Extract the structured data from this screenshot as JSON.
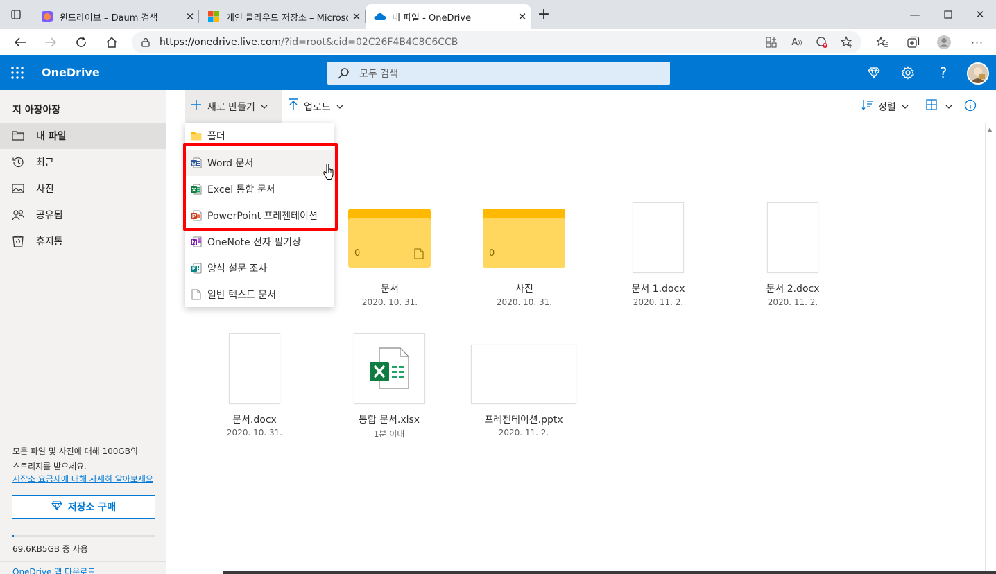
{
  "browser": {
    "tabs": [
      {
        "title": "윈드라이브 – Daum 검색",
        "active": false
      },
      {
        "title": "개인 클라우드 저장소 – Microsoft",
        "active": false
      },
      {
        "title": "내 파일 - OneDrive",
        "active": true
      }
    ],
    "url_host": "https://onedrive.live.com",
    "url_path": "/?id=root&cid=02C26F4B4C8C6CCB"
  },
  "header": {
    "brand": "OneDrive",
    "search_placeholder": "모두 검색"
  },
  "sidebar": {
    "user_name": "지 아장아장",
    "items": [
      {
        "label": "내 파일",
        "icon": "folder-icon",
        "selected": true
      },
      {
        "label": "최근",
        "icon": "history-icon",
        "selected": false
      },
      {
        "label": "사진",
        "icon": "photo-icon",
        "selected": false
      },
      {
        "label": "공유됨",
        "icon": "people-icon",
        "selected": false
      },
      {
        "label": "휴지통",
        "icon": "recycle-bin-icon",
        "selected": false
      }
    ],
    "promo_line1": "모든 파일 및 사진에 대해 100GB의",
    "promo_line2": "스토리지를 받으세요.",
    "promo_link": "저장소 요금제에 대해 자세히 알아보세요",
    "buy_label": "저장소 구매",
    "usage_text": "69.6KB5GB 중 사용",
    "download_link": "OneDrive 앱 다운로드"
  },
  "commands": {
    "new_label": "새로 만들기",
    "upload_label": "업로드",
    "sort_label": "정렬"
  },
  "new_menu": [
    {
      "label": "폴더",
      "icon": "folder-icon"
    },
    {
      "label": "Word 문서",
      "icon": "word-icon"
    },
    {
      "label": "Excel 통합 문서",
      "icon": "excel-icon"
    },
    {
      "label": "PowerPoint 프레젠테이션",
      "icon": "powerpoint-icon"
    },
    {
      "label": "OneNote 전자 필기장",
      "icon": "onenote-icon"
    },
    {
      "label": "양식 설문 조사",
      "icon": "forms-icon"
    },
    {
      "label": "일반 텍스트 문서",
      "icon": "text-file-icon"
    }
  ],
  "files": {
    "row1": [
      {
        "name": "문서",
        "date": "2020. 10. 31.",
        "type": "folder",
        "count": "0"
      },
      {
        "name": "사진",
        "date": "2020. 10. 31.",
        "type": "folder",
        "count": "0"
      },
      {
        "name": "문서 1.docx",
        "date": "2020. 11. 2.",
        "type": "docx"
      },
      {
        "name": "문서 2.docx",
        "date": "2020. 11. 2.",
        "type": "docx"
      }
    ],
    "row2": [
      {
        "name": "문서.docx",
        "date": "2020. 10. 31.",
        "type": "docx"
      },
      {
        "name": "통합 문서.xlsx",
        "date": "1분 이내",
        "type": "xlsx"
      },
      {
        "name": "프레젠테이션.pptx",
        "date": "2020. 11. 2.",
        "type": "pptx"
      }
    ]
  },
  "colors": {
    "brand_blue": "#0078d4",
    "highlight": "#ff0000",
    "folder": "#ffd75e"
  }
}
